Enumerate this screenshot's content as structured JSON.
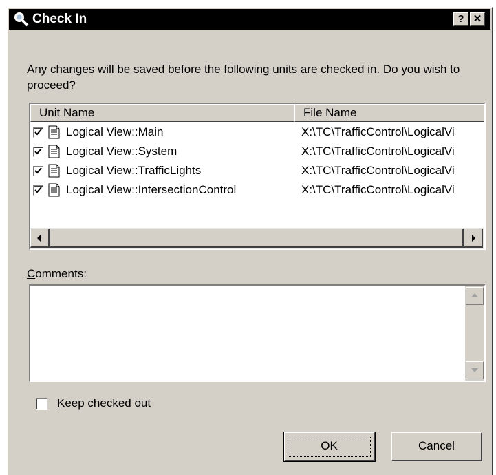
{
  "window": {
    "title": "Check In",
    "help_button": "?",
    "close_button": "✕",
    "title_icon": "magnifier-icon"
  },
  "message": "Any changes will be saved before the following units are checked in. Do you wish to proceed?",
  "unit_list": {
    "columns": [
      "Unit Name",
      "File Name"
    ],
    "rows": [
      {
        "checked": true,
        "unit_name": "Logical View::Main",
        "file_name": "X:\\TC\\TrafficControl\\LogicalVi"
      },
      {
        "checked": true,
        "unit_name": "Logical View::System",
        "file_name": "X:\\TC\\TrafficControl\\LogicalVi"
      },
      {
        "checked": true,
        "unit_name": "Logical View::TrafficLights",
        "file_name": "X:\\TC\\TrafficControl\\LogicalVi"
      },
      {
        "checked": true,
        "unit_name": "Logical View::IntersectionControl",
        "file_name": "X:\\TC\\TrafficControl\\LogicalVi"
      }
    ]
  },
  "comments": {
    "label_mnemonic": "C",
    "label_rest": "omments:",
    "value": ""
  },
  "keep_checked_out": {
    "checked": false,
    "label_mnemonic": "K",
    "label_rest": "eep checked out"
  },
  "buttons": {
    "ok": "OK",
    "cancel": "Cancel"
  }
}
